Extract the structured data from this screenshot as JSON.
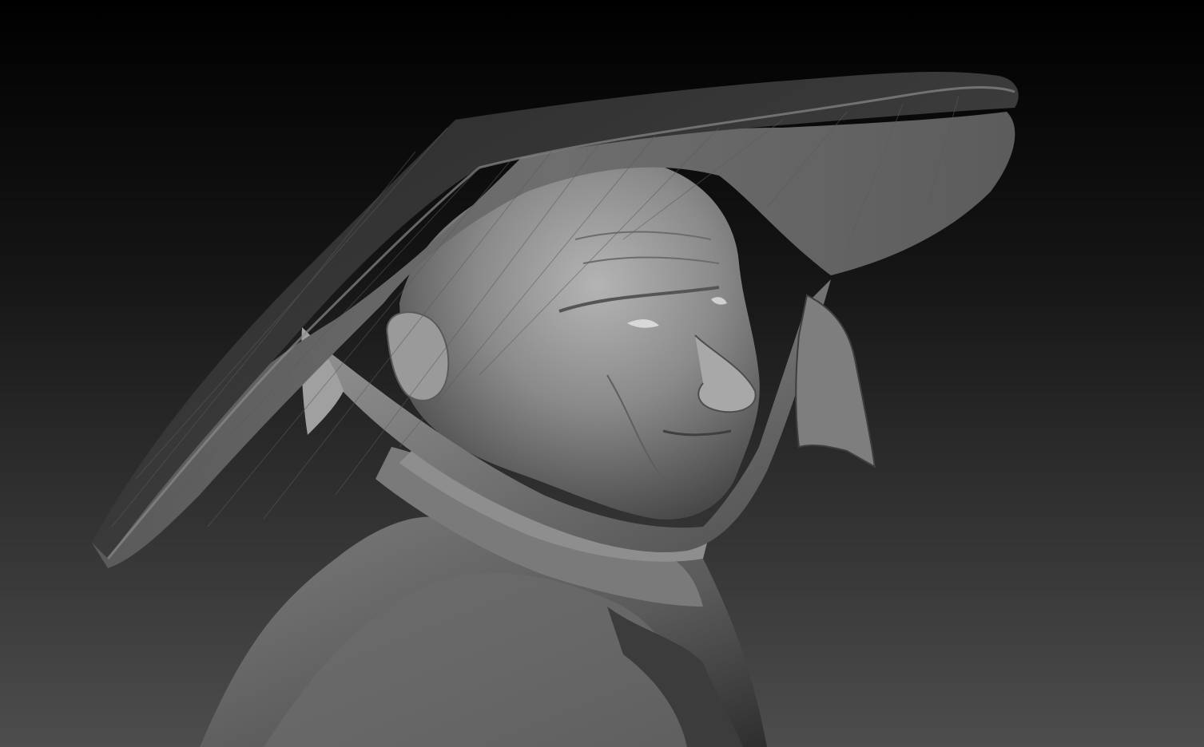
{
  "scene": {
    "subject": "sculpted-bust",
    "render_style": "grayscale-matcap",
    "colors": {
      "background_top": "#000000",
      "background_bottom": "#4a4a4a",
      "hat": "#3a3a3a",
      "skin": "#8a8a8a",
      "cloth": "#6e6e6e"
    }
  }
}
